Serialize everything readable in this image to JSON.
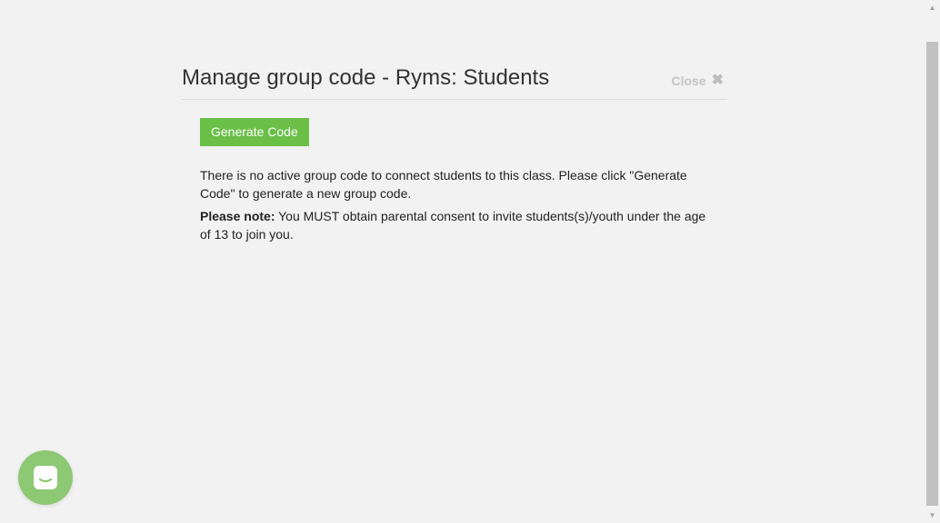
{
  "modal": {
    "title": "Manage group code - Ryms: Students",
    "close_label": "Close",
    "close_icon": "✖",
    "generate_button_label": "Generate Code",
    "info_text": "There is no active group code to connect students to this class. Please click \"Generate Code\" to generate a new group code.",
    "note_label": "Please note:",
    "note_text": " You MUST obtain parental consent to invite students(s)/youth under the age of 13 to join you."
  },
  "scrollbar": {
    "up_arrow": "▲",
    "down_arrow": "▼"
  },
  "chat": {
    "icon": "chat-bubble-icon",
    "color": "#8dc873"
  },
  "colors": {
    "accent_green": "#6abf47",
    "background": "#f2f2f2"
  }
}
